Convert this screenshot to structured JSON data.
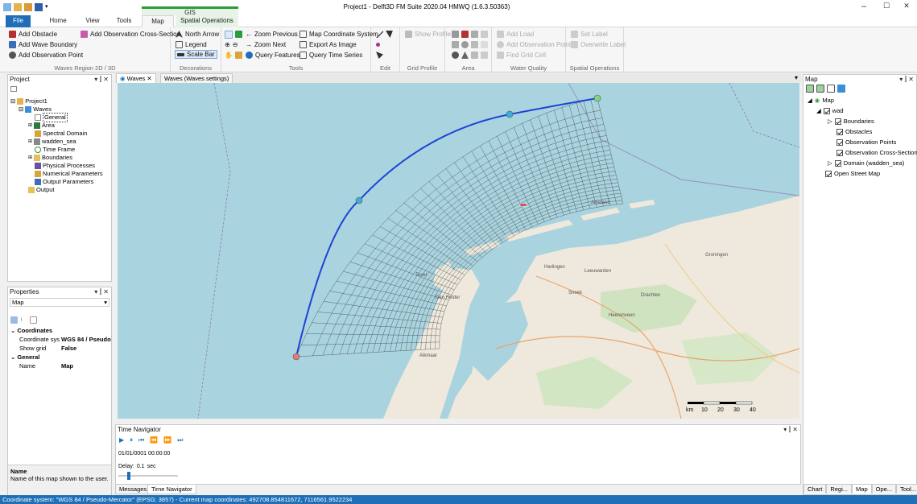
{
  "window": {
    "title": "Project1 - Delft3D FM Suite 2020.04 HMWQ (1.6.3.50363)",
    "minimize": "–",
    "maximize": "☐",
    "close": "✕"
  },
  "context_band": {
    "label": "GIS"
  },
  "ribbon_tabs": [
    "File",
    "Home",
    "View",
    "Tools",
    "Map",
    "Spatial Operations"
  ],
  "ribbon": {
    "waves_region": {
      "label": "Waves Region 2D / 3D",
      "add_obstacle": "Add Obstacle",
      "add_obs_cross": "Add Observation Cross-Section",
      "add_wave_boundary": "Add Wave Boundary",
      "add_obs_point": "Add Observation Point"
    },
    "decorations": {
      "label": "Decorations",
      "north_arrow": "North Arrow",
      "legend": "Legend",
      "scale_bar": "Scale Bar"
    },
    "tools": {
      "label": "Tools",
      "zoom_previous": "Zoom Previous",
      "zoom_next": "Zoom Next",
      "query_features": "Query Features",
      "map_coord_system": "Map Coordinate System",
      "export_image": "Export As Image",
      "query_time_series": "Query Time Series"
    },
    "edit": {
      "label": "Edit"
    },
    "grid_profile": {
      "label": "Grid Profile",
      "show_profile": "Show Profile"
    },
    "area": {
      "label": "Area"
    },
    "water_quality": {
      "label": "Water Quality",
      "add_load": "Add Load",
      "add_obs_point": "Add Observation Point",
      "find_grid_cell": "Find Grid Cell"
    },
    "spatial_ops": {
      "label": "Spatial Operations",
      "set_label": "Set Label",
      "overwrite_label": "Overwrite Label"
    }
  },
  "project_panel": {
    "title": "Project",
    "controls": "▾  ⫿  ✕",
    "tree": [
      "Project1",
      "Waves",
      "General",
      "Area",
      "Spectral Domain",
      "wadden_sea",
      "Time Frame",
      "Boundaries",
      "Physical Processes",
      "Numerical Parameters",
      "Output Parameters",
      "Output"
    ]
  },
  "properties_panel": {
    "title": "Properties",
    "controls": "▾  ⫿  ✕",
    "object": "Map",
    "section_coordinates": "Coordinates",
    "coord_label": "Coordinate sys",
    "coord_value": "WGS 84 / Pseudo-M",
    "grid_label": "Show grid",
    "grid_value": "False",
    "section_general": "General",
    "name_label": "Name",
    "name_value": "Map",
    "desc_title": "Name",
    "desc_text": "Name of this map shown to the user."
  },
  "doc_tabs": [
    "Waves ✕",
    "Waves (Waves settings)"
  ],
  "map": {
    "place_labels": [
      "Ameland",
      "Harlingen",
      "Leeuwarden",
      "Groningen",
      "Drachten",
      "Heerenveen",
      "Sneek",
      "Den Helder",
      "Alkmaar",
      "Texel"
    ],
    "scale": {
      "unit": "km",
      "ticks": [
        "10",
        "20",
        "30",
        "40"
      ]
    }
  },
  "time_navigator": {
    "title": "Time Navigator",
    "controls": "▾  ⫿  ✕",
    "time": "01/01/0001 00:00:00",
    "delay_label": "Delay:",
    "delay_value": "0.1",
    "delay_unit": "sec"
  },
  "bottom_tabs": [
    "Messages",
    "Time Navigator"
  ],
  "map_panel": {
    "title": "Map",
    "controls": "▾  ⫿  ✕",
    "layers": [
      "Map",
      "wad",
      "Boundaries",
      "Obstacles",
      "Observation Points",
      "Observation Cross-Sections",
      "Domain (wadden_sea)",
      "Open Street Map"
    ]
  },
  "right_tabs": [
    "Chart",
    "Regi...",
    "Map",
    "Ope...",
    "Tool..."
  ],
  "status_text": "Coordinate system: \"WGS 84 / Pseudo-Mercator\" (EPSG: 3857)  -  Current map coordinates: 492708.854811672, 7116561.9522234"
}
